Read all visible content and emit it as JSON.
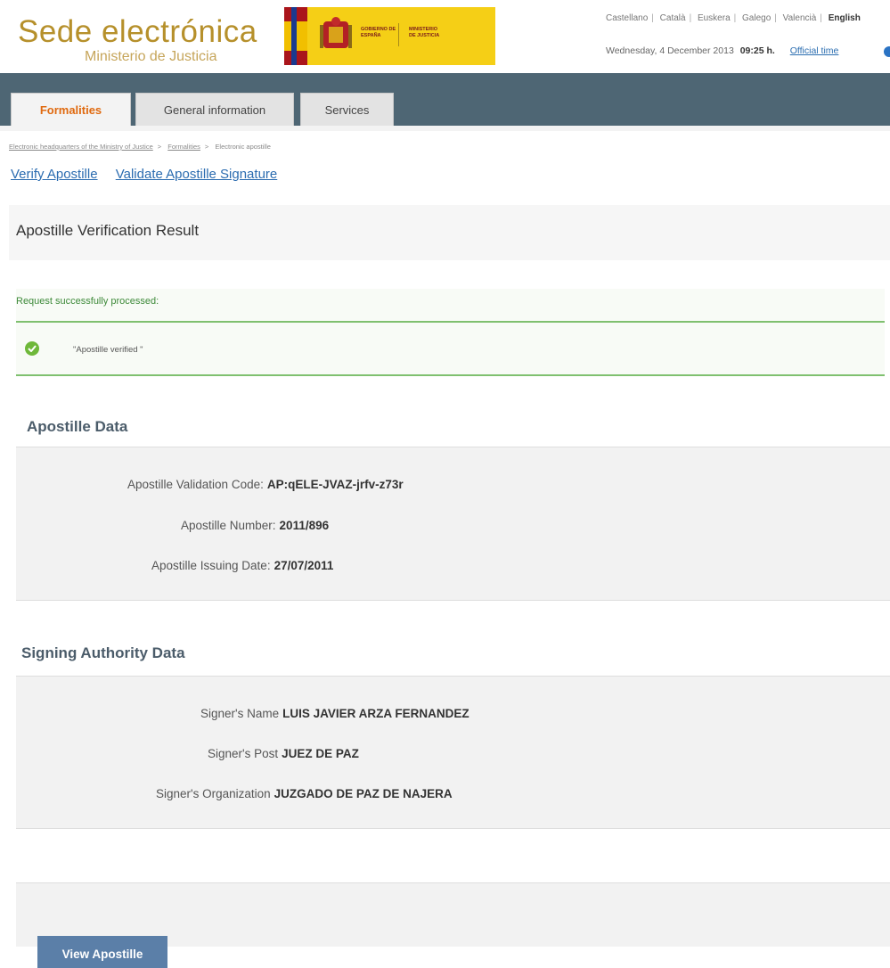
{
  "header": {
    "site_title": "Sede electrónica",
    "site_subtitle": "Ministerio de Justicia",
    "gov_logo_text1": "GOBIERNO DE ESPAÑA",
    "gov_logo_text2": "MINISTERIO DE JUSTICIA",
    "languages": [
      "Castellano",
      "Català",
      "Euskera",
      "Galego",
      "Valencià",
      "English"
    ],
    "active_language": "English",
    "date": "Wednesday, 4 December 2013",
    "time": "09:25 h.",
    "official_time_label": "Official time"
  },
  "nav": {
    "tabs": [
      {
        "label": "Formalities"
      },
      {
        "label": "General information"
      },
      {
        "label": "Services"
      }
    ]
  },
  "breadcrumb": {
    "items": [
      "Electronic headquarters of the Ministry of Justice",
      "Formalities",
      "Electronic apostille"
    ]
  },
  "sublinks": [
    "Verify Apostille",
    "Validate Apostille Signature"
  ],
  "result": {
    "title": "Apostille Verification Result",
    "success_message": "Request successfully processed:",
    "verified_message": "\"Apostille verified \""
  },
  "apostille_data": {
    "title": "Apostille Data",
    "rows": [
      {
        "label": "Apostille Validation Code:",
        "value": "AP:qELE-JVAZ-jrfv-z73r"
      },
      {
        "label": "Apostille Number:",
        "value": "2011/896"
      },
      {
        "label": "Apostille Issuing Date:",
        "value": "27/07/2011"
      }
    ]
  },
  "signer_data": {
    "title": "Signing Authority Data",
    "rows": [
      {
        "label": "Signer's Name",
        "value": "LUIS JAVIER ARZA FERNANDEZ"
      },
      {
        "label": "Signer's Post",
        "value": "JUEZ DE PAZ"
      },
      {
        "label": "Signer's Organization",
        "value": "JUZGADO DE PAZ DE NAJERA"
      }
    ]
  },
  "actions": {
    "view_button": "View Apostille"
  },
  "colors": {
    "brand_gold": "#b6902b",
    "nav_bar": "#4e6674",
    "active_tab_text": "#e06a10",
    "link": "#2b6cb0",
    "success_green": "#3e8a3a",
    "button": "#5b7fa8"
  }
}
